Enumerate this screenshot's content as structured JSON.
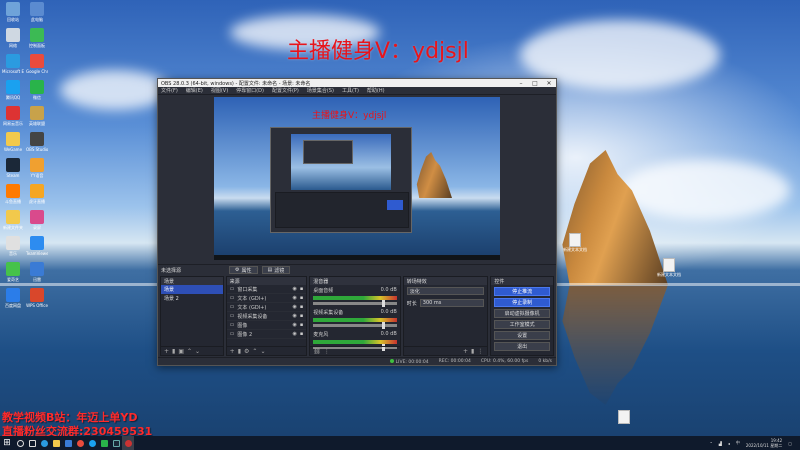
{
  "overlay": {
    "banner": "主播健身V：ydjsjl",
    "footer_line1": "教学视频B站：年迈上单YD",
    "footer_line2": "直播粉丝交流群:230459531"
  },
  "obs": {
    "title": "OBS 28.0.3 (64-bit, windows) - 配置文件: 未命名 - 场景: 未命名",
    "menu": [
      "文件(F)",
      "编辑(E)",
      "视图(V)",
      "停靠窗口(D)",
      "配置文件(P)",
      "场景集合(S)",
      "工具(T)",
      "帮助(H)"
    ],
    "preview_banner": "主播健身V：ydjsjl",
    "scene_name_label": "未选择源",
    "properties_button": "属性",
    "filters_button": "滤镜",
    "docks": {
      "scenes_title": "场景",
      "scenes": [
        "场景",
        "场景 2"
      ],
      "sources_title": "来源",
      "sources": [
        "窗口采集",
        "文本 (GDI+)",
        "文本 (GDI+)",
        "视频采集设备",
        "图像",
        "图像 2"
      ],
      "mixer_title": "混音器",
      "mixer": [
        {
          "name": "桌面音频",
          "db": "0.0 dB"
        },
        {
          "name": "视频采集设备",
          "db": "0.0 dB"
        },
        {
          "name": "麦克风",
          "db": "0.0 dB"
        }
      ],
      "transitions_title": "转场特效",
      "transition_type": "淡化",
      "duration_label": "时长",
      "duration_value": "300 ms",
      "controls_title": "控件",
      "controls": [
        "停止推流",
        "停止录制",
        "启动虚拟摄像机",
        "工作室模式",
        "设置",
        "退出"
      ]
    },
    "status": {
      "live": "LIVE: 00:00:04",
      "rec": "REC: 00:00:04",
      "cpu": "CPU: 0.4%, 60.00 fps",
      "bitrate": "0 kb/s"
    }
  },
  "desktop": {
    "left_icons": [
      "回收站",
      "此电脑",
      "网络",
      "控制面板",
      "Microsoft Edge",
      "Google Chrome",
      "腾讯QQ",
      "微信",
      "网易云音乐",
      "英雄联盟",
      "WeGame",
      "OBS Studio",
      "Steam",
      "YY语音",
      "斗鱼直播",
      "虎牙直播",
      "新建文件夹",
      "录屏",
      "音乐",
      "TeamViewer",
      "爱奇艺",
      "迅雷",
      "百度网盘",
      "WPS Office"
    ],
    "right_icons": [
      "新建文本文档",
      "新建文本文档"
    ]
  },
  "taskbar": {
    "time": "19:42",
    "date": "2022/10/11 星期二",
    "lang": "中"
  },
  "colors": {
    "accent_blue": "#2f5bd0",
    "banner_red": "#e8141b",
    "obs_bg": "#2b2e38"
  }
}
